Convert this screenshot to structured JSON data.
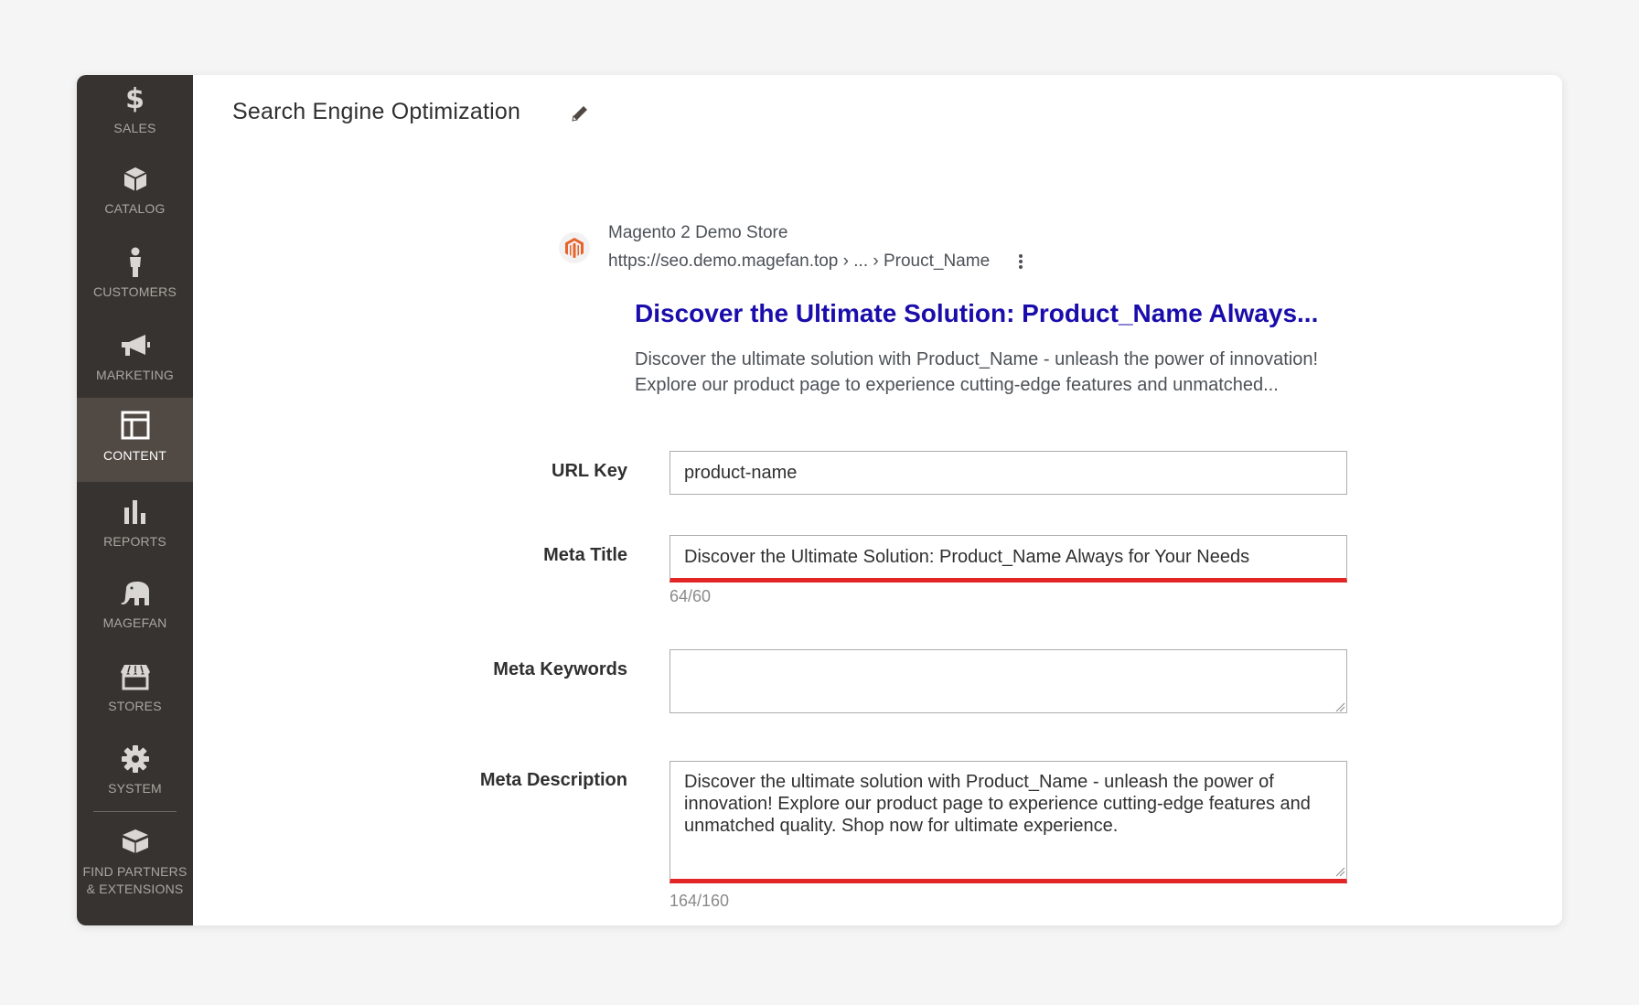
{
  "sidebar": {
    "items": [
      {
        "label": "SALES",
        "icon": "dollar-icon"
      },
      {
        "label": "CATALOG",
        "icon": "box-icon"
      },
      {
        "label": "CUSTOMERS",
        "icon": "person-icon"
      },
      {
        "label": "MARKETING",
        "icon": "megaphone-icon"
      },
      {
        "label": "CONTENT",
        "icon": "layout-icon",
        "active": true
      },
      {
        "label": "REPORTS",
        "icon": "bar-chart-icon"
      },
      {
        "label": "MAGEFAN",
        "icon": "elephant-icon"
      },
      {
        "label": "STORES",
        "icon": "storefront-icon"
      },
      {
        "label": "SYSTEM",
        "icon": "gear-icon"
      }
    ],
    "partners": {
      "line1": "FIND PARTNERS",
      "line2": "& EXTENSIONS",
      "icon": "blocks-icon"
    }
  },
  "section": {
    "title": "Search Engine Optimization",
    "edit_icon": "pencil-icon"
  },
  "preview": {
    "site_name": "Magento 2 Demo Store",
    "url": "https://seo.demo.magefan.top › ... › Prouct_Name",
    "title": "Discover the Ultimate Solution: Product_Name Always...",
    "description_line1": "Discover the ultimate solution with Product_Name - unleash the power of innovation!",
    "description_line2": "Explore our product page to experience cutting-edge features and unmatched...",
    "logo_icon": "magento-logo-icon",
    "more_icon": "kebab-icon"
  },
  "form": {
    "url_key": {
      "label": "URL Key",
      "value": "product-name"
    },
    "meta_title": {
      "label": "Meta Title",
      "value": "Discover the Ultimate Solution: Product_Name Always for Your Needs",
      "counter": "64/60"
    },
    "meta_keywords": {
      "label": "Meta Keywords",
      "value": ""
    },
    "meta_description": {
      "label": "Meta Description",
      "value": "Discover the ultimate solution with Product_Name - unleash the power of innovation! Explore our product page to experience cutting-edge features and unmatched quality. Shop now for ultimate experience.",
      "counter": "164/160"
    }
  },
  "colors": {
    "sidebar_bg": "#373330",
    "active_bg": "#514943",
    "error": "#e22626",
    "serp_title": "#1a0dab"
  }
}
